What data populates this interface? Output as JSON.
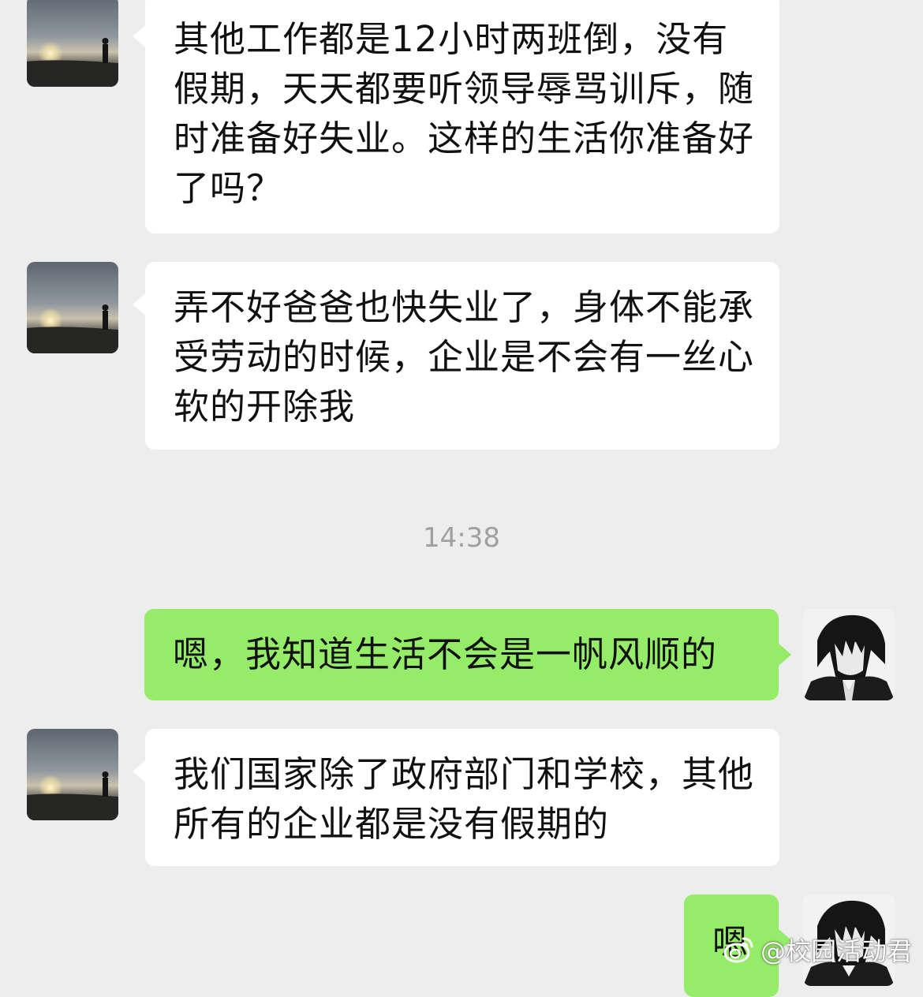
{
  "messages": [
    {
      "side": "in",
      "text": "其他工作都是12小时两班倒，没有假期，天天都要听领导辱骂训斥，随时准备好失业。这样的生活你准备好了吗？"
    },
    {
      "side": "in",
      "text": "弄不好爸爸也快失业了，身体不能承受劳动的时候，企业是不会有一丝心软的开除我"
    },
    {
      "side": "out",
      "text": "嗯，我知道生活不会是一帆风顺的"
    },
    {
      "side": "in",
      "text": "我们国家除了政府部门和学校，其他所有的企业都是没有假期的"
    },
    {
      "side": "out",
      "text": "嗯"
    }
  ],
  "timestamp": "14:38",
  "watermark": {
    "icon": "weibo-icon",
    "text": "@校园活动君"
  },
  "colors": {
    "background": "#ededed",
    "incoming_bubble": "#ffffff",
    "outgoing_bubble": "#95ec69",
    "timestamp": "#a0a0a0"
  }
}
